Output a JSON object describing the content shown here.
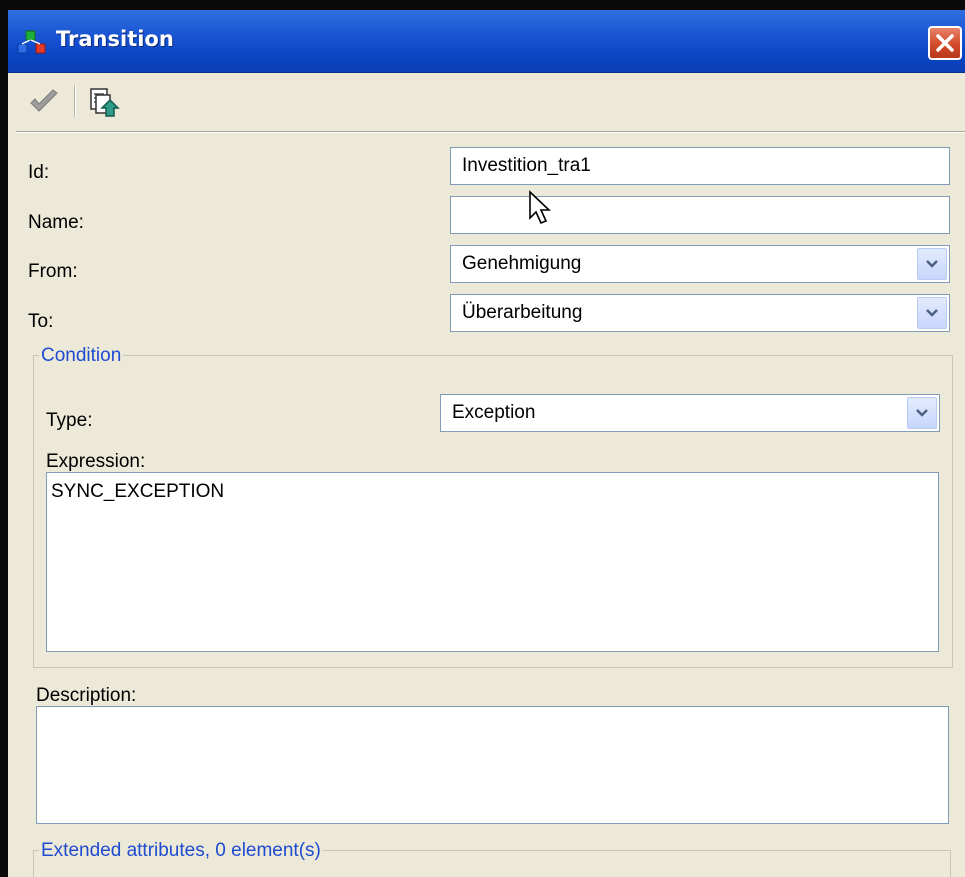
{
  "window": {
    "title": "Transition"
  },
  "toolbar": {
    "apply_icon": "checkmark-icon",
    "upload_icon": "upload-document-icon"
  },
  "form": {
    "id_label": "Id:",
    "id_value": "Investition_tra1",
    "name_label": "Name:",
    "name_value": "",
    "from_label": "From:",
    "from_value": "Genehmigung",
    "to_label": "To:",
    "to_value": "Überarbeitung"
  },
  "condition": {
    "legend": "Condition",
    "type_label": "Type:",
    "type_value": "Exception",
    "expression_label": "Expression:",
    "expression_value": "SYNC_EXCEPTION"
  },
  "description": {
    "label": "Description:",
    "value": ""
  },
  "extended": {
    "legend": "Extended attributes, 0 element(s)"
  },
  "colors": {
    "titlebar": "#0a46c6",
    "legend": "#1f4bd1",
    "background": "#ece9d8",
    "close": "#d24b2a"
  }
}
